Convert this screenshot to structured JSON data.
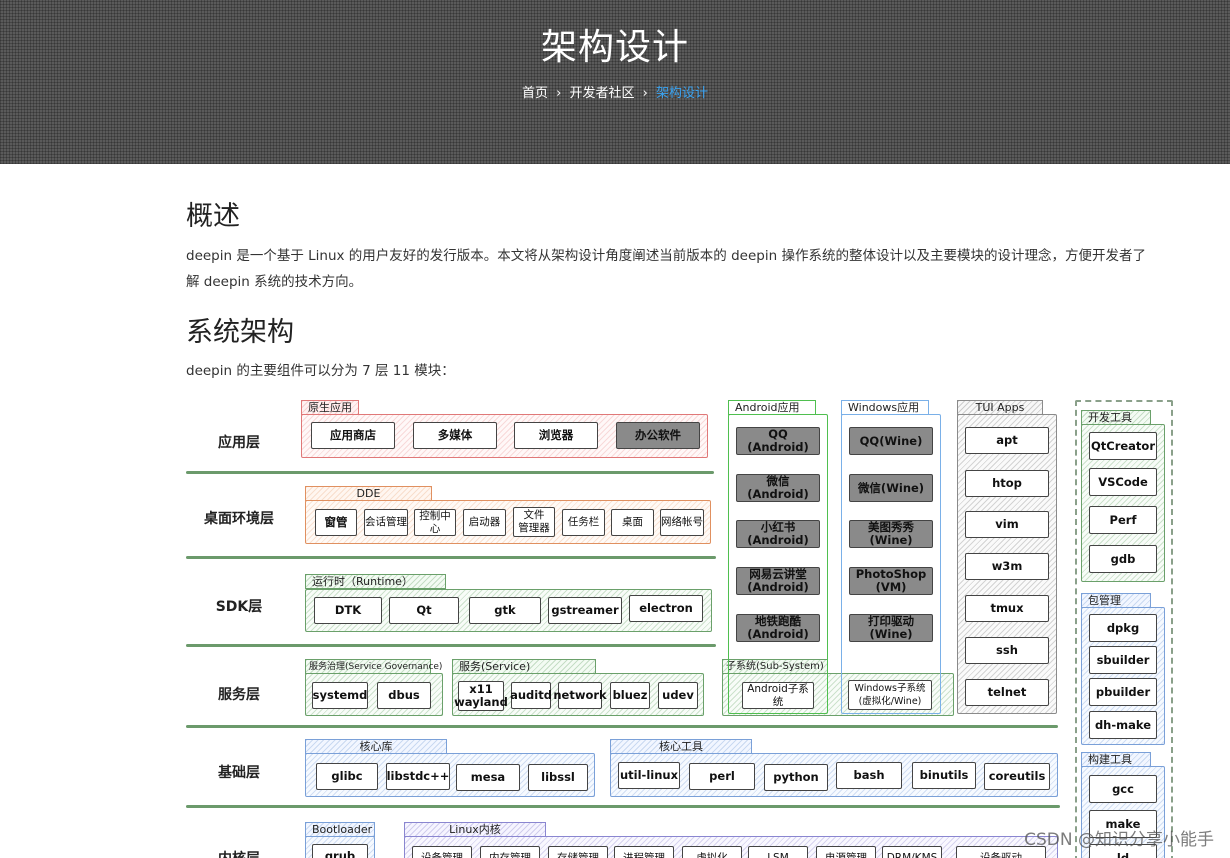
{
  "hero": {
    "title": "架构设计",
    "breadcrumb": {
      "home": "首页",
      "community": "开发者社区",
      "current": "架构设计",
      "separator": "›"
    }
  },
  "overview": {
    "heading": "概述",
    "text_line1": "deepin 是一个基于 Linux 的用户友好的发行版本。本文将从架构设计角度阐述当前版本的 deepin 操作系统的整体设计以及主要模块的设计理念，方便开发者了",
    "text_line2": "解 deepin 系统的技术方向。"
  },
  "architecture": {
    "heading": "系统架构",
    "intro": "deepin 的主要组件可以分为 7 层 11 模块："
  },
  "diagram": {
    "layers": [
      "应用层",
      "桌面环境层",
      "SDK层",
      "服务层",
      "基础层",
      "内核层"
    ],
    "app_layer": {
      "group": "原生应用",
      "items": [
        "应用商店",
        "多媒体",
        "浏览器",
        "办公软件"
      ]
    },
    "desktop_layer": {
      "group": "DDE",
      "items": [
        "窗管",
        "会话管理",
        "控制中心",
        "启动器",
        "文件\n管理器",
        "任务栏",
        "桌面",
        "网络帐号"
      ]
    },
    "sdk_layer": {
      "group": "运行时（Runtime）",
      "items": [
        "DTK",
        "Qt",
        "gtk",
        "gstreamer",
        "electron"
      ]
    },
    "service_layer": {
      "governance_group": "服务治理(Service Governance)",
      "governance_items": [
        "systemd",
        "dbus"
      ],
      "service_group": "服务(Service)",
      "service_items": [
        "x11\nwayland",
        "auditd",
        "network",
        "bluez",
        "udev"
      ],
      "subsystem_group": "子系统(Sub-System)",
      "subsystem_items": [
        "Android子系统",
        "Windows子系统\n(虚拟化/Wine)"
      ]
    },
    "base_layer": {
      "core_lib_group": "核心库",
      "core_lib_items": [
        "glibc",
        "libstdc++",
        "mesa",
        "libssl"
      ],
      "core_tools_group": "核心工具",
      "core_tools_items": [
        "util-linux",
        "perl",
        "python",
        "bash",
        "binutils",
        "coreutils"
      ]
    },
    "kernel_layer": {
      "bootloader_group": "Bootloader",
      "bootloader_items": [
        "grub"
      ],
      "kernel_group": "Linux内核",
      "kernel_items": [
        "设备管理",
        "内存管理",
        "存储管理",
        "进程管理",
        "虚拟化",
        "LSM",
        "电源管理",
        "DRM/KMS",
        "设备驱动"
      ]
    },
    "android_apps": {
      "group": "Android应用",
      "items": [
        "QQ\n(Android)",
        "微信\n(Android)",
        "小红书\n(Android)",
        "网易云讲堂\n(Android)",
        "地铁跑酷\n(Android)"
      ]
    },
    "windows_apps": {
      "group": "Windows应用",
      "items": [
        "QQ(Wine)",
        "微信(Wine)",
        "美图秀秀\n(Wine)",
        "PhotoShop\n(VM)",
        "打印驱动\n(Wine)"
      ]
    },
    "tui_apps": {
      "group": "TUI Apps",
      "items": [
        "apt",
        "htop",
        "vim",
        "w3m",
        "tmux",
        "ssh",
        "telnet"
      ]
    },
    "dev_tools": {
      "group": "开发工具",
      "items": [
        "QtCreator",
        "VSCode",
        "Perf",
        "gdb"
      ]
    },
    "package_mgmt": {
      "group": "包管理",
      "items": [
        "dpkg",
        "sbuilder",
        "pbuilder",
        "dh-make"
      ]
    },
    "build_tools": {
      "group": "构建工具",
      "items": [
        "gcc",
        "make",
        "ld"
      ]
    }
  },
  "watermark": "CSDN @知识分享小能手"
}
